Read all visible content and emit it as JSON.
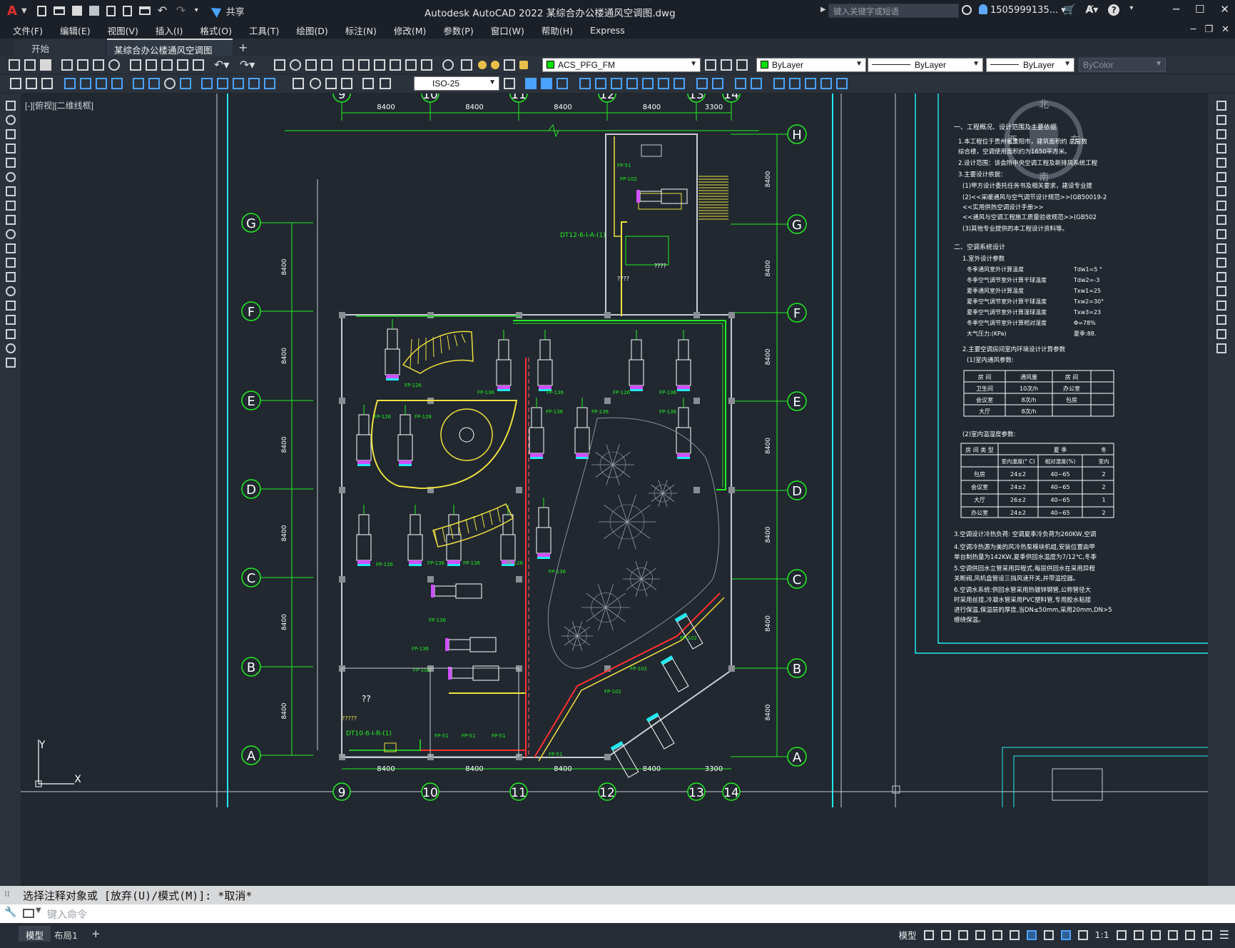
{
  "app": {
    "title": "Autodesk AutoCAD 2022    某综合办公楼通风空调图.dwg",
    "share_label": "共享",
    "search_placeholder": "键入关键字或短语",
    "user_name": "1505999135...",
    "logo": "A"
  },
  "menu": [
    "文件(F)",
    "编辑(E)",
    "视图(V)",
    "插入(I)",
    "格式(O)",
    "工具(T)",
    "绘图(D)",
    "标注(N)",
    "修改(M)",
    "参数(P)",
    "窗口(W)",
    "帮助(H)",
    "Express"
  ],
  "file_tabs": [
    {
      "label": "开始",
      "active": false
    },
    {
      "label": "某综合办公楼通风空调图*",
      "active": true
    }
  ],
  "toolbar": {
    "layer": "ACS_PFG_FM",
    "color": "ByLayer",
    "linetype": "ByLayer",
    "lineweight": "ByLayer",
    "plotstyle": "ByColor",
    "dimstyle": "ISO-25"
  },
  "viewport": {
    "label": "[-][俯视][二维线框]"
  },
  "drawing": {
    "top_axes": [
      "9",
      "10",
      "11",
      "12",
      "13",
      "14"
    ],
    "row_axes": [
      "H",
      "G",
      "F",
      "E",
      "D",
      "C",
      "B",
      "A"
    ],
    "left_row_axes": [
      "G",
      "F",
      "E",
      "D",
      "C",
      "B",
      "A"
    ],
    "top_dims": [
      "8400",
      "8400",
      "8400",
      "8400",
      "3300"
    ],
    "bottom_dims": [
      "8400",
      "8400",
      "8400",
      "8400",
      "3300"
    ],
    "side_dim": "8400",
    "compass": {
      "north": "北",
      "south": "南",
      "east": "东",
      "west": "西"
    },
    "ucs": {
      "x": "X",
      "y": "Y"
    },
    "unit_labels": {
      "fp126": "FP-126",
      "fp136": "FP-136",
      "fp102": "FP-102",
      "fp51": "FP-51",
      "dt12": "DT12-6-I-A-(1)",
      "dt10": "DT10-6-I-R-(1)",
      "qq": "??",
      "q4": "????",
      "q5": "?????"
    },
    "notes": {
      "h1": "一、工程概况、设计范围及主要依据",
      "l1": "1.本工程位于贵州省贵阳市，建筑面积约   总层数",
      "l1b": "  综合楼，空调使用面积约为1650平方米。",
      "l2": "2.设计范围：该会所中央空调工程及新排风系统工程",
      "l3": "3.主要设计依据：",
      "l3a": "(1)甲方设计委托任务书及相关要求，建设专业提",
      "l3b": "(2)<<采暖通风与空气调节设计规范>>(GB50019-2",
      "l3c": "   <<实用供热空调设计手册>>",
      "l3d": "   <<通风与空调工程施工质量验收规范>>(GB502",
      "l3e": "(3)其他专业提供的本工程设计资料等。",
      "h2": "二、空调系统设计",
      "p1": "1.室外设计参数",
      "params": [
        [
          "冬季通风室外计算温度",
          "Tdw1=5 °"
        ],
        [
          "冬季空气调节室外计算干球温度",
          "Tdw2=-3"
        ],
        [
          "夏季通风室外计算温度",
          "Txw1=25"
        ],
        [
          "夏季空气调节室外计算干球温度",
          "Txw2=30°"
        ],
        [
          "夏季空气调节室外计算湿球温度",
          "Txw3=23"
        ],
        [
          "冬季空气调节室外计算相对湿度",
          "Φ=78%"
        ],
        [
          "大气压力:(KPa)",
          "夏季:88."
        ]
      ],
      "p2": "2.主要空调房间室内环境设计计算参数",
      "p2a": "(1)室内通风参数:",
      "vent_header": [
        "房 间",
        "通风量",
        "房 间"
      ],
      "vent_rows": [
        [
          "卫生间",
          "10次/h",
          "办公室"
        ],
        [
          "会议室",
          "8次/h",
          "包房"
        ],
        [
          "大厅",
          "8次/h",
          ""
        ]
      ],
      "p2b": "(2)室内温湿度参数:",
      "th_header": [
        "房 间 类 型",
        "夏    季",
        "冬"
      ],
      "th_sub": [
        "室内温度(° C)",
        "相对湿度(%)",
        "室内"
      ],
      "th_rows": [
        [
          "包房",
          "24±2",
          "40~65",
          "2"
        ],
        [
          "会议室",
          "24±2",
          "40~65",
          "2"
        ],
        [
          "大厅",
          "26±2",
          "40~65",
          "1"
        ],
        [
          "办公室",
          "24±2",
          "40~65",
          "2"
        ]
      ],
      "l4": "3.空调设计冷热负荷:  空调夏季冷负荷为260KW,空调",
      "l5": "4.空调冷热源为美的风冷热泵模块机组,安装位置由甲",
      "l5b": "  单台制热量为142KW,夏季供回水温度为7/12℃,冬季",
      "l6": "5.空调供回水立管采用异程式,每层供回水在采用异程",
      "l6b": "  关断阀,风机盘管设三挡风速开关,并带温控器。",
      "l7": "6.空调水系统:供回水管采用热镀锌钢管,公称管径大",
      "l7b": "  时采用丝接,冷凝水管采用PVC塑料管,专用胶水粘接",
      "l7c": "  进行保温,保温层的厚度,当DN≤50mm,采用20mm,DN>5",
      "l7d": "  缠绕保温。"
    }
  },
  "command": {
    "history": "选择注释对象或 [放弃(U)/模式(M)]: *取消*",
    "placeholder": "键入命令"
  },
  "layout_tabs": [
    {
      "label": "模型",
      "active": true
    },
    {
      "label": "布局1",
      "active": false
    }
  ],
  "status": {
    "model": "模型",
    "scale": "1:1"
  }
}
